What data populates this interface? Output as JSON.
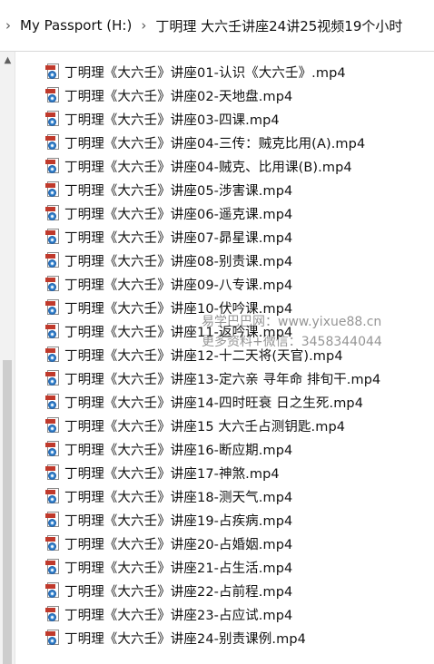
{
  "breadcrumb": {
    "items": [
      "My Passport (H:)",
      "丁明理 大六壬讲座24讲25视频19个小时"
    ],
    "separator": "›"
  },
  "scrollbar": {
    "up_arrow": "▲"
  },
  "files": [
    "丁明理《大六壬》讲座01-认识《大六壬》.mp4",
    "丁明理《大六壬》讲座02-天地盘.mp4",
    "丁明理《大六壬》讲座03-四课.mp4",
    "丁明理《大六壬》讲座04-三传：贼克比用(A).mp4",
    "丁明理《大六壬》讲座04-贼克、比用课(B).mp4",
    "丁明理《大六壬》讲座05-涉害课.mp4",
    "丁明理《大六壬》讲座06-遥克课.mp4",
    "丁明理《大六壬》讲座07-昴星课.mp4",
    "丁明理《大六壬》讲座08-别责课.mp4",
    "丁明理《大六壬》讲座09-八专课.mp4",
    "丁明理《大六壬》讲座10-伏吟课.mp4",
    "丁明理《大六壬》讲座11-返吟课.mp4",
    "丁明理《大六壬》讲座12-十二天将(天官).mp4",
    "丁明理《大六壬》讲座13-定六亲 寻年命 排旬干.mp4",
    "丁明理《大六壬》讲座14-四时旺衰 日之生死.mp4",
    "丁明理《大六壬》讲座15 大六壬占测钥匙.mp4",
    "丁明理《大六壬》讲座16-断应期.mp4",
    "丁明理《大六壬》讲座17-神煞.mp4",
    "丁明理《大六壬》讲座18-测天气.mp4",
    "丁明理《大六壬》讲座19-占疾病.mp4",
    "丁明理《大六壬》讲座20-占婚姻.mp4",
    "丁明理《大六壬》讲座21-占生活.mp4",
    "丁明理《大六壬》讲座22-占前程.mp4",
    "丁明理《大六壬》讲座23-占应试.mp4",
    "丁明理《大六壬》讲座24-别责课例.mp4"
  ],
  "watermark": {
    "line1": "易学巴巴网：www.yixue88.cn",
    "line2": "更多资料+微信：3458344044"
  },
  "colors": {
    "file_icon_strip": "#c0392b",
    "file_icon_disc": "#3f8fd8",
    "text": "#111111"
  }
}
